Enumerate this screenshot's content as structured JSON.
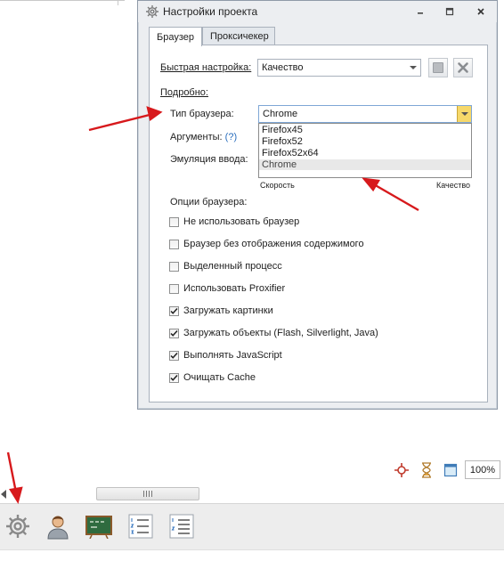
{
  "dialog": {
    "title": "Настройки проекта",
    "tabs": [
      "Браузер",
      "Проксичекер"
    ],
    "quick_setting": {
      "label": "Быстрая настройка:",
      "value": "Качество"
    },
    "details_label": "Подробно:",
    "browser_type": {
      "label": "Тип браузера:",
      "value": "Chrome"
    },
    "arguments": {
      "label": "Аргументы:",
      "help": "(?)"
    },
    "input_emulation": {
      "label": "Эмуляция ввода:"
    },
    "browser_options": [
      "Firefox45",
      "Firefox52",
      "Firefox52x64",
      "Chrome"
    ],
    "slider": {
      "left_label": "Скорость",
      "right_label": "Качество"
    },
    "options_label": "Опции браузера:",
    "checkboxes": [
      {
        "label": "Не использовать браузер",
        "checked": false
      },
      {
        "label": "Браузер без отображения содержимого",
        "checked": false
      },
      {
        "label": "Выделенный процесс",
        "checked": false
      },
      {
        "label": "Использовать Proxifier",
        "checked": false
      },
      {
        "label": "Загружать картинки",
        "checked": true
      },
      {
        "label": "Загружать объекты (Flash, Silverlight, Java)",
        "checked": true
      },
      {
        "label": "Выполнять JavaScript",
        "checked": true
      },
      {
        "label": "Очищать Cache",
        "checked": true
      }
    ]
  },
  "toolbar": {
    "zoom": "100%",
    "icons": [
      "crosshair-icon",
      "hourglass-icon",
      "window-icon"
    ]
  },
  "bottom_bar": {
    "icons": [
      "gear-icon",
      "user-icon",
      "chalkboard-icon",
      "numbered-list-icon",
      "numbered-list-alt-icon"
    ]
  },
  "colors": {
    "annotation_arrow": "#d7191c",
    "focus_dropdown": "#f6d86a"
  }
}
